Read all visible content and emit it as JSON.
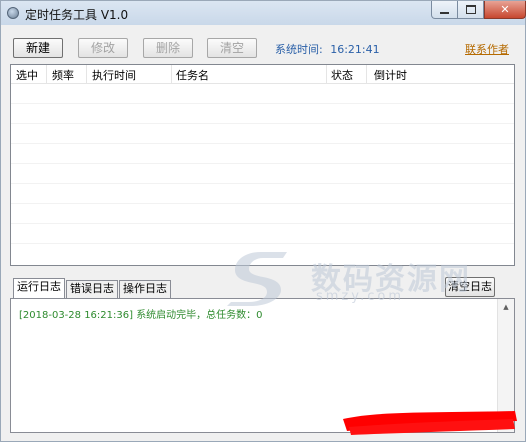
{
  "window": {
    "title": "定时任务工具 V1.0"
  },
  "toolbar": {
    "new_label": "新建",
    "edit_label": "修改",
    "delete_label": "删除",
    "clear_label": "清空",
    "system_time_label": "系统时间:",
    "system_time_value": "16:21:41",
    "author_link": "联系作者"
  },
  "task_grid": {
    "columns": [
      "选中",
      "频率",
      "执行时间",
      "任务名",
      "状态",
      "倒计时"
    ],
    "rows": []
  },
  "log": {
    "tabs": [
      "运行日志",
      "错误日志",
      "操作日志"
    ],
    "selected_tab": 0,
    "clear_button": "清空日志",
    "lines": [
      "[2018-03-28 16:21:36] 系统启动完毕，总任务数：0"
    ]
  },
  "watermark": {
    "text": "数码资源网",
    "url": "smzy.com"
  },
  "colors": {
    "time_text": "#2a60a8",
    "author_link": "#b56a00",
    "log_text": "#2e8b2e",
    "close_button": "#c7472f"
  },
  "icons": {
    "app": "app-icon",
    "minimize": "minimize-icon",
    "maximize": "maximize-icon",
    "close": "close-icon"
  }
}
